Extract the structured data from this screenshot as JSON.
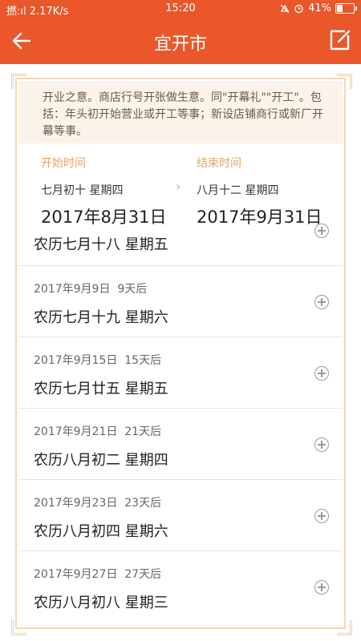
{
  "status_bar": {
    "signal": "撚:ıl 2.17K/s",
    "time": "15:20",
    "battery_percent": "41%",
    "battery_level": 0.41
  },
  "nav": {
    "title": "宜开市",
    "back_icon": "back-arrow-icon",
    "edit_icon": "edit-icon"
  },
  "description": "开业之意。商店行号开张做生意。同\"开幕礼\"\"开工\"。包括：年头初开始营业或开工等事；新设店铺商行或新厂开幕等事。",
  "range": {
    "start_label": "开始时间",
    "start_lunar": "七月初十 星期四",
    "start_date": "2017年8月31日",
    "end_label": "结束时间",
    "end_lunar": "八月十二 星期四",
    "end_date": "2017年9月31日",
    "arrow": "›"
  },
  "results": [
    {
      "date": "",
      "offset": "",
      "lunar": "农历七月十八 星期五"
    },
    {
      "date": "2017年9月9日",
      "offset": "9天后",
      "lunar": "农历七月十九 星期六"
    },
    {
      "date": "2017年9月15日",
      "offset": "15天后",
      "lunar": "农历七月廿五 星期五"
    },
    {
      "date": "2017年9月21日",
      "offset": "21天后",
      "lunar": "农历八月初二 星期四"
    },
    {
      "date": "2017年9月23日",
      "offset": "23天后",
      "lunar": "农历八月初四 星期六"
    },
    {
      "date": "2017年9月27日",
      "offset": "27天后",
      "lunar": "农历八月初八 星期三"
    }
  ]
}
